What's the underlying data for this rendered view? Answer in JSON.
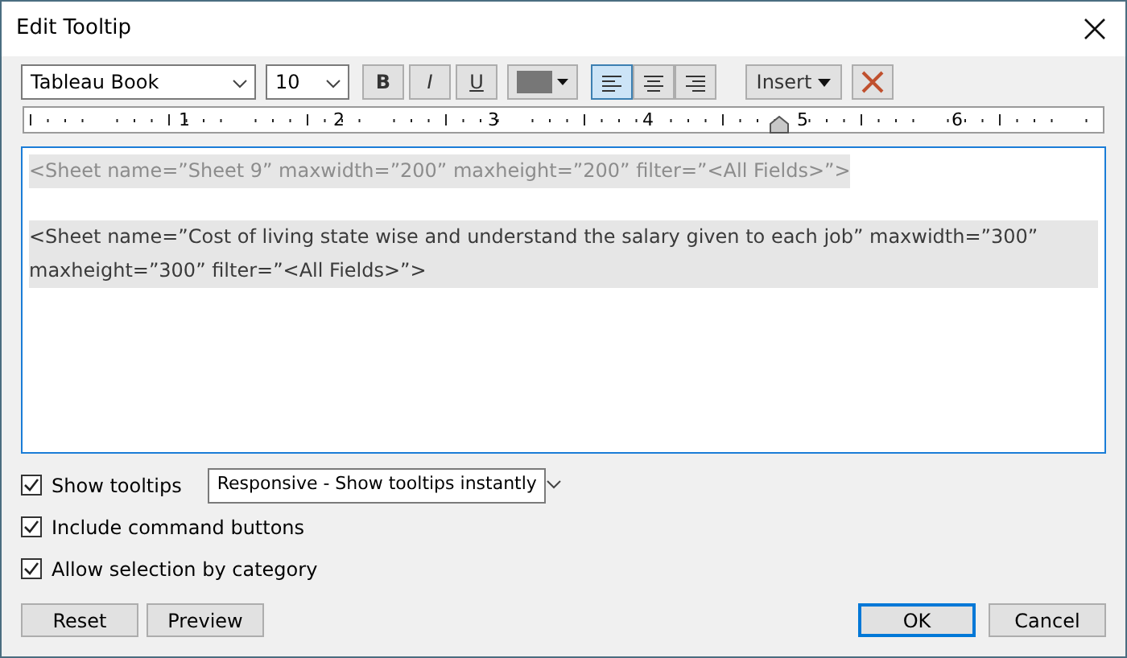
{
  "window": {
    "title": "Edit Tooltip"
  },
  "toolbar": {
    "font": "Tableau Book",
    "size": "10",
    "styles": [
      {
        "kind": "bold",
        "label": "B"
      },
      {
        "kind": "italic",
        "label": "I"
      },
      {
        "kind": "underline",
        "label": "U"
      }
    ],
    "alignments": [
      {
        "kind": "left",
        "selected": true
      },
      {
        "kind": "center",
        "selected": false
      },
      {
        "kind": "right",
        "selected": false
      }
    ],
    "insert": "Insert"
  },
  "ruler": {
    "labels": [
      "1",
      "2",
      "3",
      "4",
      "5",
      "6"
    ],
    "level": 0.7
  },
  "editor": {
    "paragraphs": [
      {
        "text": "<Sheet name=”Sheet 9” maxwidth=”200” maxheight=”200” filter=”<All Fields>”>",
        "color": "#8c8c8c"
      },
      {
        "text": "<Sheet name=”Cost of living state wise and understand the salary given to each job” maxwidth=”300” maxheight=”300” filter=”<All Fields>”>",
        "color": "#3a3a3a"
      }
    ]
  },
  "options": [
    {
      "label": "Show tooltips",
      "checked": true,
      "dropdown": "Responsive - Show tooltips instantly"
    },
    {
      "label": "Include command buttons",
      "checked": true
    },
    {
      "label": "Allow selection by category",
      "checked": true
    }
  ],
  "buttons_left": [
    {
      "label": "Reset",
      "default": false
    },
    {
      "label": "Preview",
      "default": false
    }
  ],
  "buttons_right": [
    {
      "label": "OK",
      "default": true
    },
    {
      "label": "Cancel",
      "default": false
    }
  ]
}
